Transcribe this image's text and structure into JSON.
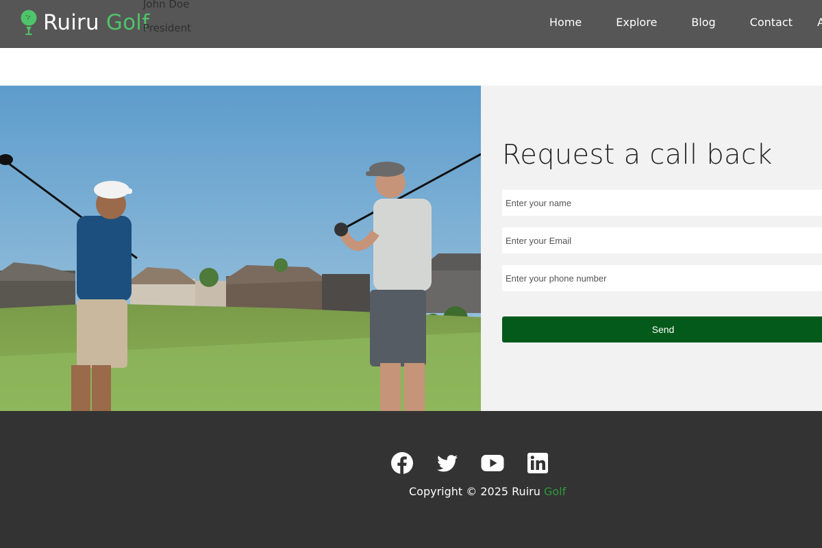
{
  "header": {
    "brand_main": "Ruiru",
    "brand_accent": "Golf",
    "overlay_name": "John Doe",
    "overlay_role": "President",
    "nav": [
      "Home",
      "Explore",
      "Blog",
      "Contact",
      "A"
    ]
  },
  "form": {
    "title": "Request a call back",
    "name_placeholder": "Enter your name",
    "email_placeholder": "Enter your Email",
    "phone_placeholder": "Enter your phone number",
    "send_label": "Send"
  },
  "footer": {
    "socials": [
      "facebook-icon",
      "twitter-icon",
      "youtube-icon",
      "linkedin-icon"
    ],
    "copyright_main": "Copyright © 2025 Ruiru",
    "copyright_accent": "Golf"
  },
  "colors": {
    "header_bg": "#565656",
    "brand_accent": "#4fc46a",
    "send_button": "#045a1b",
    "footer_bg": "#333333",
    "footer_accent": "#2f9a3a"
  }
}
